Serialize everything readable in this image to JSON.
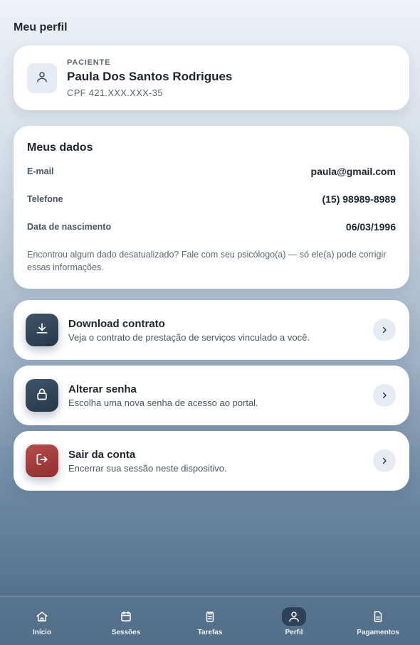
{
  "page": {
    "title": "Meu perfil"
  },
  "patient": {
    "label": "PACIENTE",
    "name": "Paula Dos Santos Rodrigues",
    "cpf": "CPF 421.XXX.XXX-35",
    "icon": "user-icon"
  },
  "data": {
    "title": "Meus dados",
    "rows": [
      {
        "label": "E-mail",
        "value": "paula@gmail.com"
      },
      {
        "label": "Telefone",
        "value": "(15) 98989-8989"
      },
      {
        "label": "Data de nascimento",
        "value": "06/03/1996"
      }
    ],
    "note": "Encontrou algum dado desatualizado? Fale com seu psicólogo(a) — só ele(a) pode corrigir essas informações."
  },
  "actions": [
    {
      "title": "Download contrato",
      "subtitle": "Veja o contrato de prestação de serviços vinculado a você.",
      "icon": "download-icon",
      "color": "#2f4458"
    },
    {
      "title": "Alterar senha",
      "subtitle": "Escolha uma nova senha de acesso ao portal.",
      "icon": "lock-icon",
      "color": "#2f4458"
    },
    {
      "title": "Sair da conta",
      "subtitle": "Encerrar sua sessão neste dispositivo.",
      "icon": "logout-icon",
      "color": "#a8403e"
    }
  ],
  "nav": {
    "items": [
      {
        "label": "Início",
        "icon": "home-icon"
      },
      {
        "label": "Sessões",
        "icon": "calendar-icon"
      },
      {
        "label": "Tarefas",
        "icon": "clipboard-icon"
      },
      {
        "label": "Perfil",
        "icon": "user-icon",
        "active": true
      },
      {
        "label": "Pagamentos",
        "icon": "document-icon"
      }
    ]
  }
}
